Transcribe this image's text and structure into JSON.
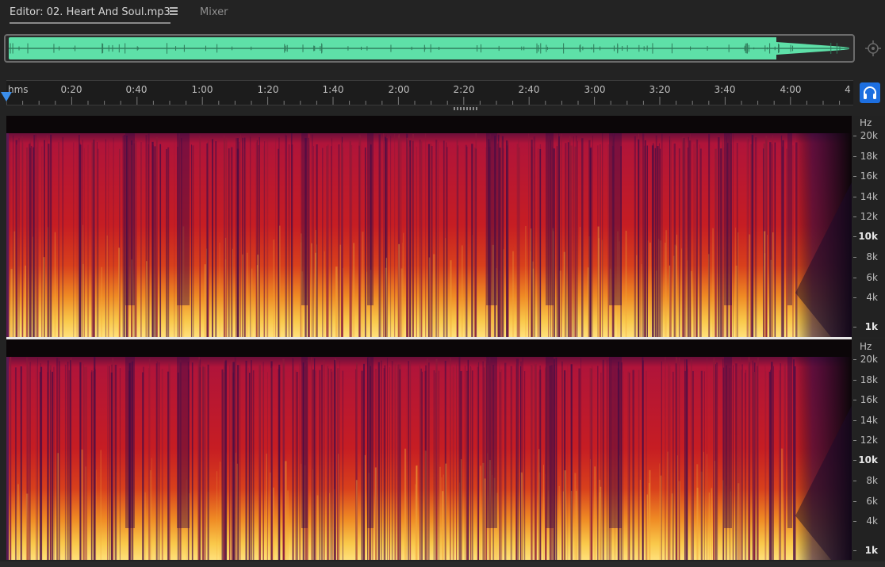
{
  "tabs": {
    "editor_label": "Editor: 02. Heart And Soul.mp3",
    "mixer_label": "Mixer"
  },
  "colors": {
    "waveform": "#5ee0a8",
    "playhead": "#3b8eea",
    "accent_button": "#1d6fe0"
  },
  "icons": {
    "menu": "hamburger-icon",
    "zoom": "zoom-navigator-icon",
    "monitor": "headphones-icon",
    "playhead": "playhead-marker-icon"
  },
  "ruler": {
    "unit": "hms",
    "labels": [
      "0:20",
      "0:40",
      "1:00",
      "1:20",
      "1:40",
      "2:00",
      "2:20",
      "2:40",
      "3:00",
      "3:20",
      "3:40",
      "4:00",
      "4"
    ]
  },
  "frequency_scale": {
    "unit": "Hz",
    "labels": [
      "20k",
      "18k",
      "16k",
      "14k",
      "12k",
      "10k",
      "8k",
      "6k",
      "4k",
      "1k"
    ]
  }
}
